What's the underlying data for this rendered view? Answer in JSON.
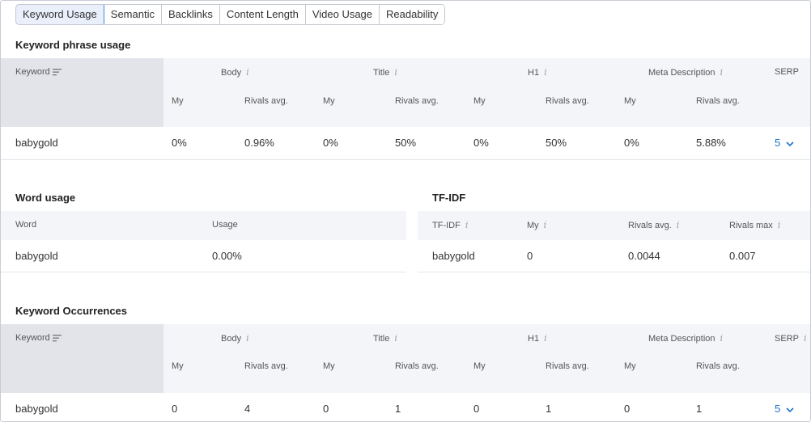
{
  "tabs": [
    "Keyword Usage",
    "Semantic",
    "Backlinks",
    "Content Length",
    "Video Usage",
    "Readability"
  ],
  "active_tab": "Keyword Usage",
  "phrase": {
    "title": "Keyword phrase usage",
    "keyword_header": "Keyword",
    "groups": [
      "Body",
      "Title",
      "H1",
      "Meta Description",
      "SERP"
    ],
    "sub": {
      "my": "My",
      "rivals": "Rivals avg."
    },
    "row": {
      "keyword": "babygold",
      "values": [
        "0%",
        "0.96%",
        "0%",
        "50%",
        "0%",
        "50%",
        "0%",
        "5.88%"
      ],
      "serp": "5"
    }
  },
  "word_usage": {
    "title": "Word usage",
    "headers": [
      "Word",
      "Usage"
    ],
    "row": [
      "babygold",
      "0.00%"
    ]
  },
  "tfidf": {
    "title": "TF-IDF",
    "headers": [
      "TF-IDF",
      "My",
      "Rivals avg.",
      "Rivals max"
    ],
    "row": [
      "babygold",
      "0",
      "0.0044",
      "0.007"
    ]
  },
  "occurrences": {
    "title": "Keyword Occurrences",
    "keyword_header": "Keyword",
    "groups": [
      "Body",
      "Title",
      "H1",
      "Meta Description",
      "SERP"
    ],
    "sub": {
      "my": "My",
      "rivals": "Rivals avg."
    },
    "row": {
      "keyword": "babygold",
      "values": [
        "0",
        "4",
        "0",
        "1",
        "0",
        "1",
        "0",
        "1"
      ],
      "serp": "5"
    }
  },
  "colors": {
    "accent": "#1a73c8",
    "header_bg": "#f4f5f9",
    "keyword_header_bg": "#e3e4ea",
    "active_tab_bg": "#e9f0fb",
    "active_tab_border": "#4c8ad6"
  }
}
